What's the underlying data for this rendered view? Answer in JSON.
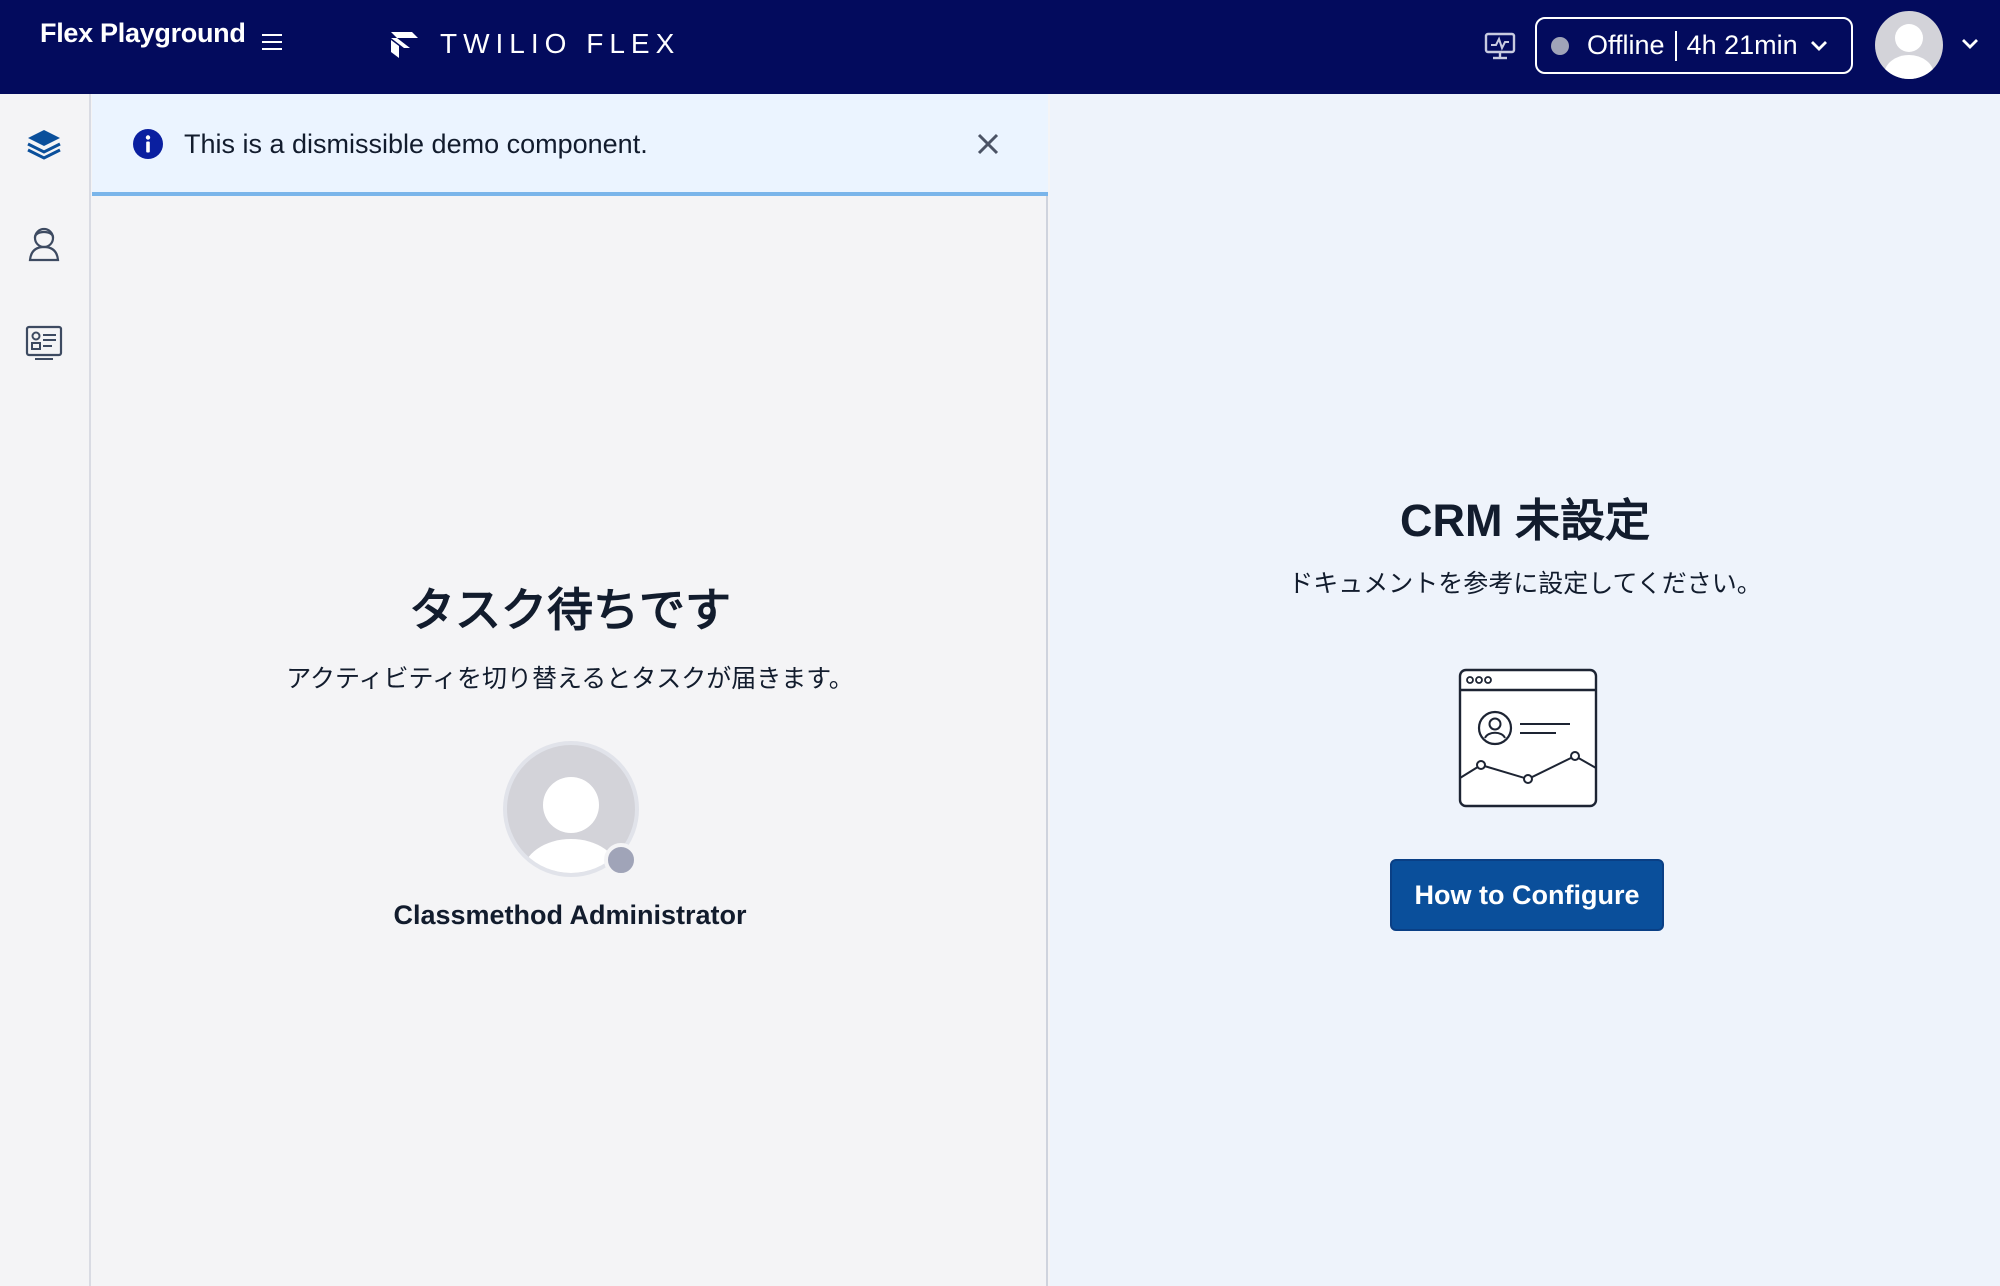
{
  "header": {
    "app_name": "Flex Playground",
    "brand_name": "TWILIO FLEX",
    "activity_status": "Offline",
    "activity_duration": "4h 21min"
  },
  "sidebar": {
    "items": [
      {
        "icon": "layers-icon"
      },
      {
        "icon": "agent-icon"
      },
      {
        "icon": "contact-card-icon"
      }
    ]
  },
  "alert": {
    "text": "This is a dismissible demo component."
  },
  "task_panel": {
    "title": "タスク待ちです",
    "subtitle": "アクティビティを切り替えるとタスクが届きます。",
    "agent_name": "Classmethod Administrator"
  },
  "crm_panel": {
    "title": "CRM 未設定",
    "subtitle": "ドキュメントを参考に設定してください。",
    "button_label": "How to Configure"
  },
  "colors": {
    "header_bg": "#030b5d",
    "primary_button": "#0a4f9b",
    "alert_bg": "#ebf4ff",
    "offline_dot": "#a0a4b8"
  }
}
